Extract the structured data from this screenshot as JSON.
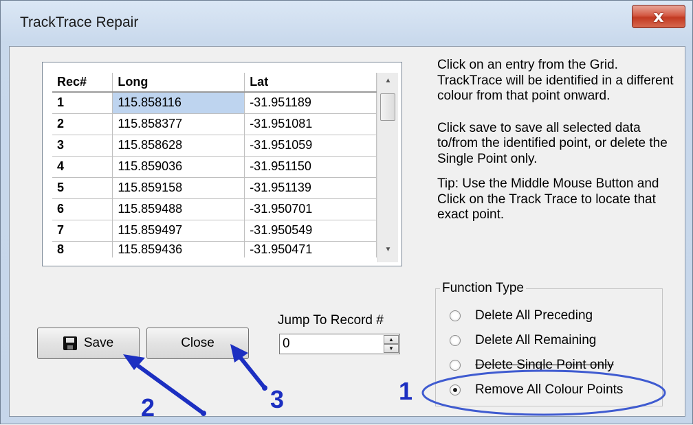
{
  "window": {
    "title": "TrackTrace Repair",
    "close_glyph": "x"
  },
  "grid": {
    "headers": [
      "Rec#",
      "Long",
      "Lat"
    ],
    "rows": [
      {
        "rec": "1",
        "long": "115.858116",
        "lat": "-31.951189"
      },
      {
        "rec": "2",
        "long": "115.858377",
        "lat": "-31.951081"
      },
      {
        "rec": "3",
        "long": "115.858628",
        "lat": "-31.951059"
      },
      {
        "rec": "4",
        "long": "115.859036",
        "lat": "-31.951150"
      },
      {
        "rec": "5",
        "long": "115.859158",
        "lat": "-31.951139"
      },
      {
        "rec": "6",
        "long": "115.859488",
        "lat": "-31.950701"
      },
      {
        "rec": "7",
        "long": "115.859497",
        "lat": "-31.950549"
      },
      {
        "rec": "8",
        "long": "115.859436",
        "lat": "-31.950471"
      }
    ]
  },
  "help": {
    "p1": "Click on an entry from the Grid. TrackTrace will be identified in a different colour from that point onward.",
    "p2": "Click save to save all selected data to/from  the identified point, or delete the Single Point only.",
    "p3": "Tip: Use the Middle Mouse Button and Click on the Track Trace  to locate that exact point."
  },
  "function_type": {
    "legend": "Function Type",
    "options": [
      {
        "label": "Delete All Preceding",
        "selected": false
      },
      {
        "label": "Delete All Remaining",
        "selected": false
      },
      {
        "label": "Delete Single Point only",
        "selected": false
      },
      {
        "label": "Remove All Colour Points",
        "selected": true
      }
    ]
  },
  "buttons": {
    "save_label": "Save",
    "close_label": "Close"
  },
  "jump": {
    "label": "Jump To Record #",
    "value": "0"
  },
  "annotations": {
    "one": "1",
    "two": "2",
    "three": "3",
    "color": "#1c2fc1"
  },
  "icons": {
    "save": "floppy-disk-icon",
    "close": "close-x-icon",
    "scroll_up": "arrow-up-icon",
    "scroll_down": "arrow-down-icon"
  }
}
